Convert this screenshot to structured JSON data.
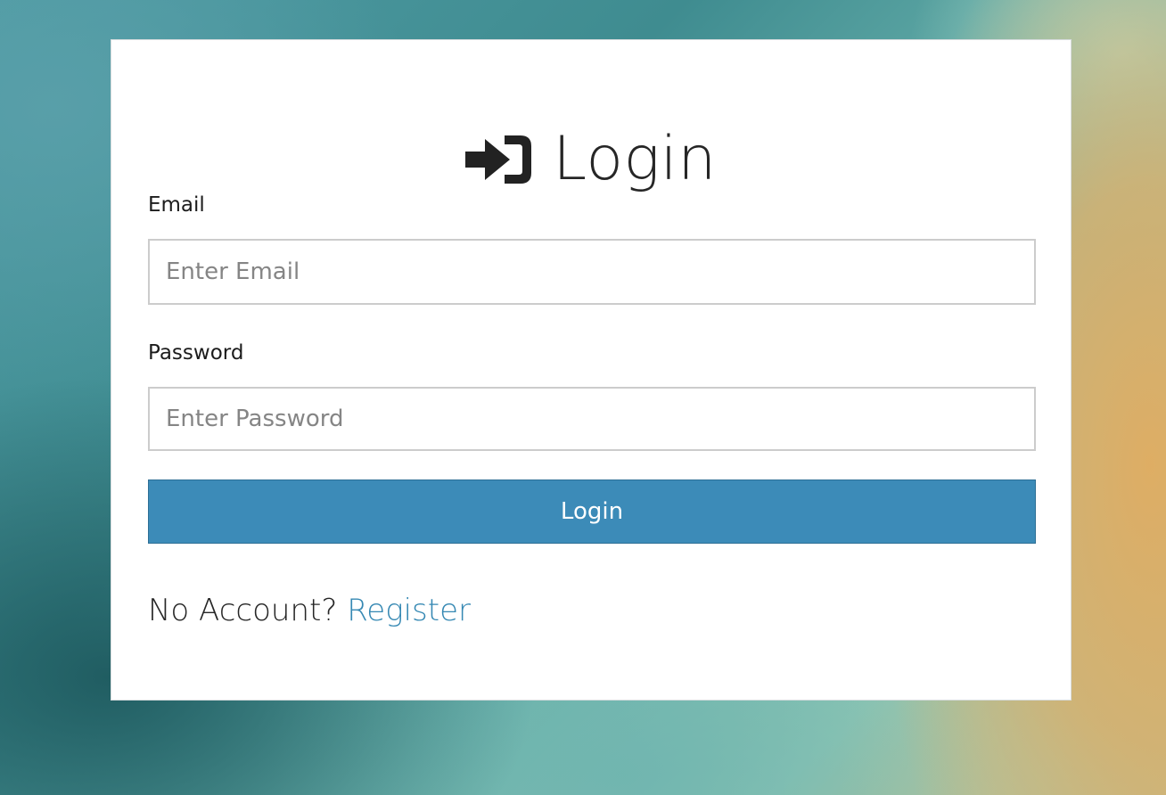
{
  "login_form": {
    "title": "Login",
    "title_icon": "sign-in-icon",
    "email": {
      "label": "Email",
      "placeholder": "Enter Email",
      "value": ""
    },
    "password": {
      "label": "Password",
      "placeholder": "Enter Password",
      "value": ""
    },
    "submit_label": "Login",
    "register_prompt": "No Account?",
    "register_link": "Register"
  },
  "colors": {
    "button": "#3c8bb8",
    "link": "#3588b3",
    "card_background": "#ffffff"
  }
}
